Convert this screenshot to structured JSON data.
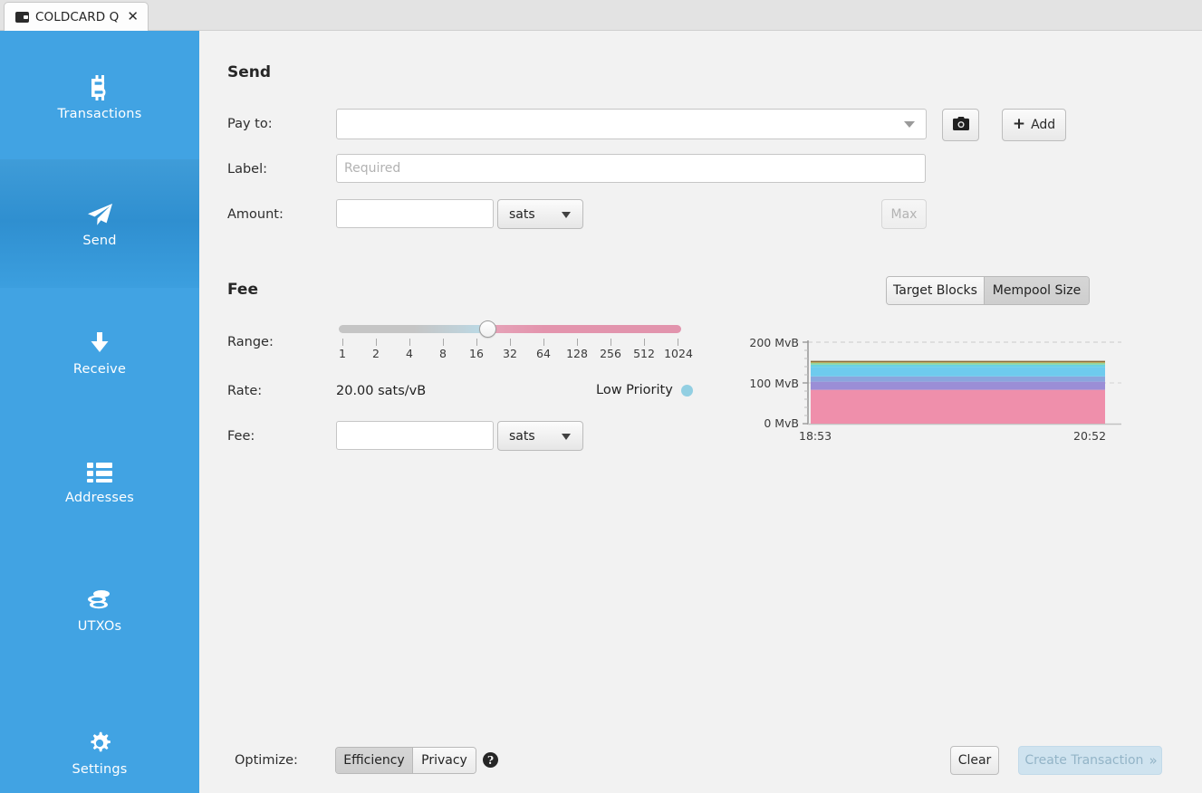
{
  "window": {
    "tab": {
      "title": "COLDCARD Q",
      "icon": "wallet-icon",
      "close": "✕"
    }
  },
  "sidebar": {
    "items": [
      {
        "label": "Transactions",
        "icon": "bitcoin-icon",
        "active": false
      },
      {
        "label": "Send",
        "icon": "paper-plane-icon",
        "active": true
      },
      {
        "label": "Receive",
        "icon": "arrow-down-icon",
        "active": false
      },
      {
        "label": "Addresses",
        "icon": "list-icon",
        "active": false
      },
      {
        "label": "UTXOs",
        "icon": "coins-icon",
        "active": false
      },
      {
        "label": "Settings",
        "icon": "gear-icon",
        "active": false
      }
    ]
  },
  "send": {
    "heading": "Send",
    "pay_to": {
      "label": "Pay to:",
      "value": "",
      "placeholder": ""
    },
    "label_field": {
      "label": "Label:",
      "value": "",
      "placeholder": "Required"
    },
    "amount": {
      "label": "Amount:",
      "value": "",
      "placeholder": "",
      "unit": "sats"
    },
    "scan_button": {
      "icon": "camera-icon",
      "label": ""
    },
    "add_button": {
      "icon": "plus-icon",
      "label": "Add"
    },
    "max_button": {
      "label": "Max",
      "disabled": true
    }
  },
  "fee": {
    "heading": "Fee",
    "range": {
      "label": "Range:",
      "ticks": [
        "1",
        "2",
        "4",
        "8",
        "16",
        "32",
        "64",
        "128",
        "256",
        "512",
        "1024"
      ],
      "handle_value": "16"
    },
    "rate": {
      "label": "Rate:",
      "value": "20.00 sats/vB"
    },
    "priority": {
      "text": "Low Priority",
      "dot_color": "#92cfe2"
    },
    "fee_input": {
      "label": "Fee:",
      "value": "",
      "unit": "sats"
    },
    "view_toggle": {
      "options": [
        "Target Blocks",
        "Mempool Size"
      ],
      "selected": "Mempool Size"
    }
  },
  "chart_data": {
    "type": "area",
    "title": "",
    "xlabel": "",
    "ylabel": "",
    "x": [
      "18:53",
      "20:52"
    ],
    "xtick_labels": [
      "18:53",
      "20:52"
    ],
    "ytick_labels": [
      "0 MvB",
      "100 MvB",
      "200 MvB"
    ],
    "ylim": [
      0,
      200
    ],
    "yunit": "MvB",
    "grid": true,
    "legend": "none",
    "stacked": true,
    "series": [
      {
        "name": "band-1",
        "color": "#ef8fab",
        "value": 83
      },
      {
        "name": "band-2",
        "color": "#9b8ed6",
        "value": 20
      },
      {
        "name": "band-3",
        "color": "#8aa6dd",
        "value": 13
      },
      {
        "name": "band-4",
        "color": "#6ecbee",
        "value": 23
      },
      {
        "name": "band-5",
        "color": "#69d2e0",
        "value": 6
      },
      {
        "name": "band-6",
        "color": "#8fd49a",
        "value": 4
      },
      {
        "name": "band-7",
        "color": "#b9a552",
        "value": 2
      },
      {
        "name": "band-8",
        "color": "#8a6b3a",
        "value": 2
      }
    ],
    "total_top": 173
  },
  "footer": {
    "optimize": {
      "label": "Optimize:",
      "options": [
        "Efficiency",
        "Privacy"
      ],
      "selected": "Efficiency",
      "help_icon": "question-mark-icon",
      "help_glyph": "?"
    },
    "clear_button": "Clear",
    "create_button": {
      "label": "Create Transaction",
      "chevron": "»",
      "disabled": true
    }
  }
}
